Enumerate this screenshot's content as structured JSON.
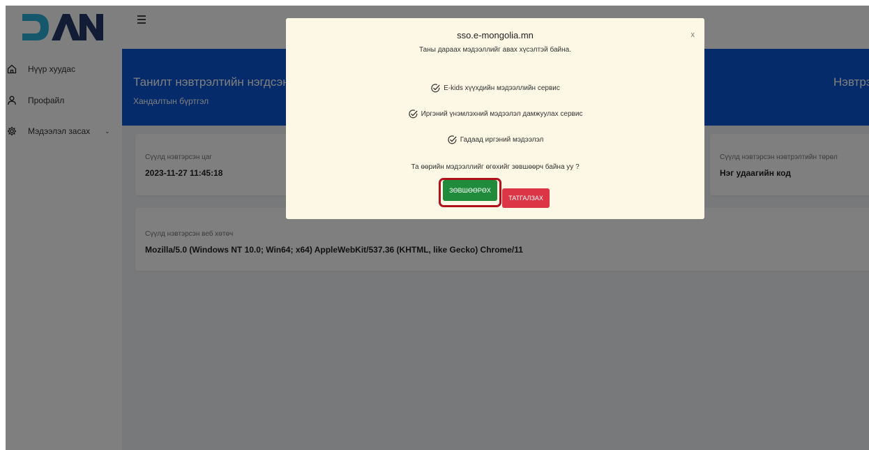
{
  "app": {
    "logo_text": "DAN",
    "brand_colors": {
      "logo_dark": "#243b6b",
      "logo_accent": "#2bb1d9",
      "banner": "#0a56d6"
    }
  },
  "sidebar": {
    "items": [
      {
        "label": "Нүүр хуудас",
        "icon": "home-icon"
      },
      {
        "label": "Профайл",
        "icon": "user-icon"
      },
      {
        "label": "Мэдээлэл засах",
        "icon": "gear-icon",
        "has_submenu": true
      }
    ]
  },
  "banner": {
    "title": "Танилт нэвтрэлтийн нэгдсэн с",
    "subtitle": "Хандалтын бүртгэл",
    "right_title": "Нэвтрэ"
  },
  "cards": {
    "last_login_time": {
      "label": "Сүүлд нэвтэрсэн цаг",
      "value": "2023-11-27 11:45:18"
    },
    "last_login_type": {
      "label": "Сүүлд нэвтэрсэн нэвтрэлтийн төрөл",
      "value": "Нэг удаагийн код"
    },
    "last_browser": {
      "label": "Сүүлд нэвтэрсэн веб хөтөч",
      "value": "Mozilla/5.0 (Windows NT 10.0; Win64; x64) AppleWebKit/537.36 (KHTML, like Gecko) Chrome/11"
    }
  },
  "modal": {
    "title": "sso.e-mongolia.mn",
    "subtitle": "Таны дараах мэдээллийг авах хүсэлтэй байна.",
    "close_label": "x",
    "permissions": [
      "E-kids хүүхдийн мэдээллийн сервис",
      "Иргэний үнэмлэхний мэдээлэл дамжуулах сервис",
      "Гадаад иргэний мэдээлэл"
    ],
    "question": "Та өөрийн мэдээллийг өгөхийг зөвшөөрч байна уу ?",
    "allow_label": "ЗӨВШӨӨРӨХ",
    "cancel_label": "ТАТГАЛЗАХ",
    "colors": {
      "allow": "#1f8b3b",
      "cancel": "#dc3545",
      "highlight": "#b0101a"
    }
  }
}
